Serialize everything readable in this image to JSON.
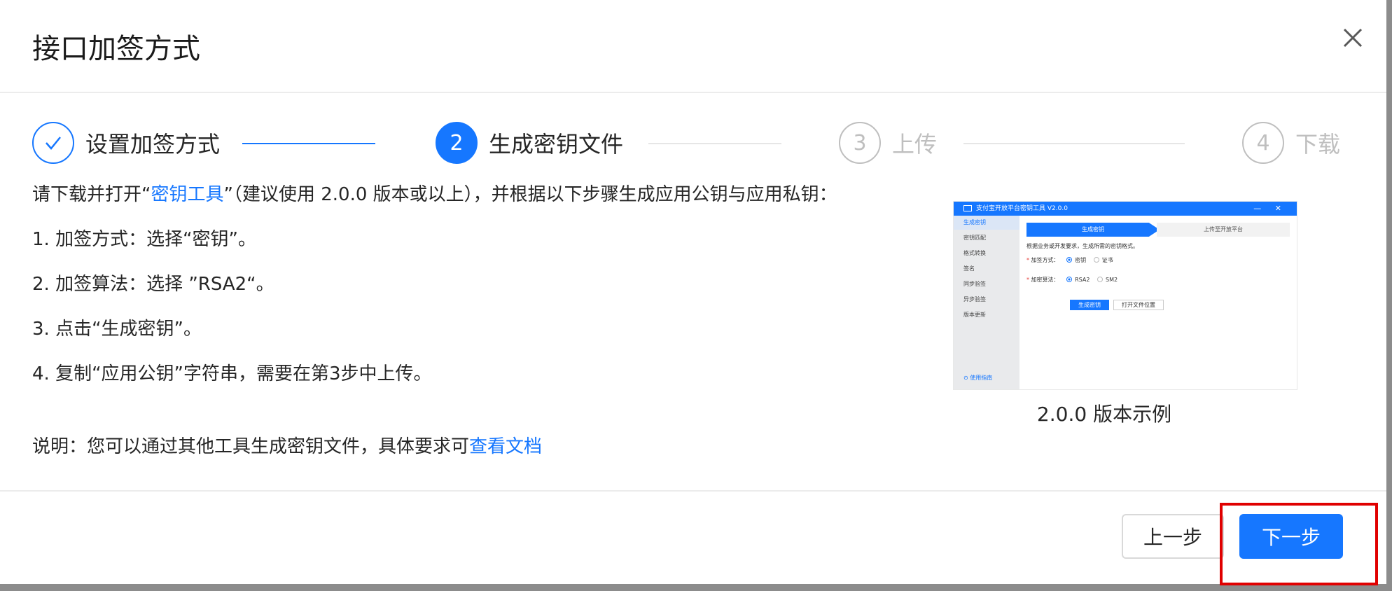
{
  "dialog": {
    "title": "接口加签方式",
    "close_icon": "close-icon"
  },
  "steps": [
    {
      "number": "",
      "label": "设置加签方式",
      "status": "done",
      "icon": "check-icon"
    },
    {
      "number": "2",
      "label": "生成密钥文件",
      "status": "active"
    },
    {
      "number": "3",
      "label": "上传",
      "status": "wait"
    },
    {
      "number": "4",
      "label": "下载",
      "status": "wait"
    }
  ],
  "instructions": {
    "intro_before": "请下载并打开“",
    "intro_link": "密钥工具",
    "intro_after": "”（建议使用 2.0.0 版本或以上），并根据以下步骤生成应用公钥与应用私钥：",
    "item1": "1. 加签方式：选择“密钥”。",
    "item2": "2. 加签算法：选择 ”RSA2“。",
    "item3": "3. 点击“生成密钥”。",
    "item4": "4. 复制“应用公钥”字符串，需要在第3步中上传。",
    "note_before": "说明：您可以通过其他工具生成密钥文件，具体要求可",
    "note_link": "查看文档"
  },
  "preview": {
    "window_title": "支付宝开放平台密钥工具 V2.0.0",
    "window_controls": "— ✕",
    "sidebar": [
      "生成密钥",
      "密钥匹配",
      "格式转换",
      "签名",
      "同步验签",
      "异步验签",
      "版本更新"
    ],
    "guide_link": "⊙ 使用指南",
    "tab_active": "生成密钥",
    "tab_inactive": "上传至开放平台",
    "hint": "根据业务或开发要求，生成所需的密钥格式。",
    "sign_mode_label": "加签方式：",
    "sign_mode_options": [
      "密钥",
      "证书"
    ],
    "algo_label": "加密算法：",
    "algo_options": [
      "RSA2",
      "SM2"
    ],
    "generate_button": "生成密钥",
    "open_location_button": "打开文件位置",
    "caption": "2.0.0 版本示例"
  },
  "footer": {
    "prev_label": "上一步",
    "next_label": "下一步"
  },
  "colors": {
    "primary": "#1677ff",
    "highlight": "#e00000",
    "inactive": "#bfbfbf"
  }
}
